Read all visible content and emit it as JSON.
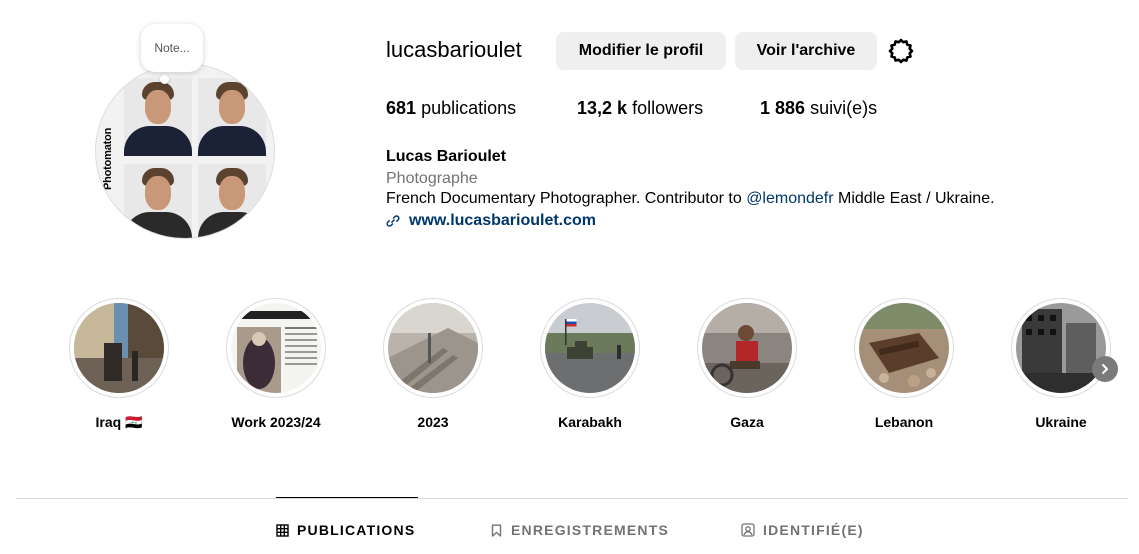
{
  "profile": {
    "note_text": "Note...",
    "avatar_print": "Photomaton",
    "username": "lucasbarioulet",
    "edit_label": "Modifier le profil",
    "archive_label": "Voir l'archive",
    "settings_icon": "gear-icon",
    "stats": {
      "posts_count": "681",
      "posts_label": "publications",
      "followers_count": "13,2 k",
      "followers_label": "followers",
      "following_count": "1 886",
      "following_label": "suivi(e)s"
    },
    "full_name": "Lucas Barioulet",
    "category": "Photographe",
    "bio_before": "French Documentary Photographer. Contributor to ",
    "bio_mention": "@lemondefr",
    "bio_after": " Middle East / Ukraine.",
    "website": "www.lucasbarioulet.com",
    "link_icon": "link-icon"
  },
  "highlights": [
    {
      "label": "Iraq 🇮🇶"
    },
    {
      "label": "Work 2023/24"
    },
    {
      "label": "2023"
    },
    {
      "label": "Karabakh"
    },
    {
      "label": "Gaza"
    },
    {
      "label": "Lebanon"
    },
    {
      "label": "Ukraine"
    }
  ],
  "highlights_next_icon": "chevron-right-icon",
  "tabs": [
    {
      "label": "PUBLICATIONS",
      "icon": "grid-icon",
      "active": true
    },
    {
      "label": "ENREGISTREMENTS",
      "icon": "bookmark-icon",
      "active": false
    },
    {
      "label": "IDENTIFIÉ(E)",
      "icon": "tagged-person-icon",
      "active": false
    }
  ],
  "colors": {
    "button_bg": "#efefef",
    "link": "#00376b",
    "secondary_text": "#737373",
    "divider": "#dbdbdb"
  }
}
